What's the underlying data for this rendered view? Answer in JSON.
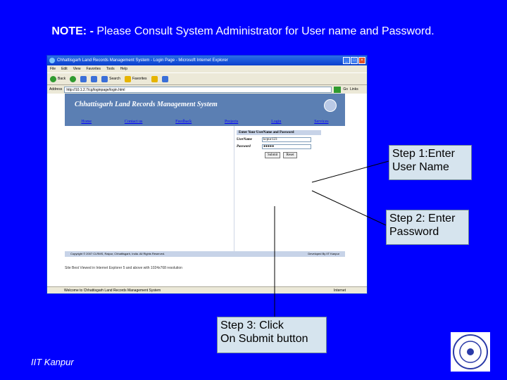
{
  "note": {
    "prefix": "NOTE: -",
    "text": "Please Consult System Administrator for User name and Password."
  },
  "window": {
    "title": "Chhattisgarh Land Records Management System - Login Page - Microsoft Internet Explorer",
    "menu": [
      "File",
      "Edit",
      "View",
      "Favorites",
      "Tools",
      "Help"
    ],
    "toolbar": [
      "Back",
      "Search",
      "Favorites"
    ],
    "address_label": "Address",
    "address": "http://10.1.2.7/cg/loginpage/login.html",
    "go": "Go",
    "links": "Links"
  },
  "site": {
    "title": "Chhattisgarh Land Records Management System",
    "nav": [
      "Home",
      "Contact us",
      "Feedback",
      "Projects",
      "Login",
      "Services"
    ],
    "login": {
      "heading": "Enter Your UserName and Password",
      "username_label": "UserName",
      "username_value": "kcpuc123",
      "password_label": "Password",
      "password_value": "●●●●●",
      "submit": "Submit",
      "reset": "Reset"
    },
    "footer_left": "Copyright © 2007 CLRMS, Raipur, Chhattisgarh, India. All Rights Reserved.",
    "footer_right": "Developed By IIT Kanpur",
    "bestview": "Site Best Viewed in Internet Explorer 5 and above with 1024x768 resolution"
  },
  "statusbar": {
    "text": "Welcome to Chhattisgarh Land Records Management System",
    "zone": "Internet"
  },
  "callouts": {
    "step1": [
      "Step 1:Enter",
      "User Name"
    ],
    "step2": [
      "Step 2: Enter",
      "Password"
    ],
    "step3": [
      "Step 3: Click",
      "On Submit button"
    ]
  },
  "footer": {
    "brand": "IIT Kanpur"
  }
}
